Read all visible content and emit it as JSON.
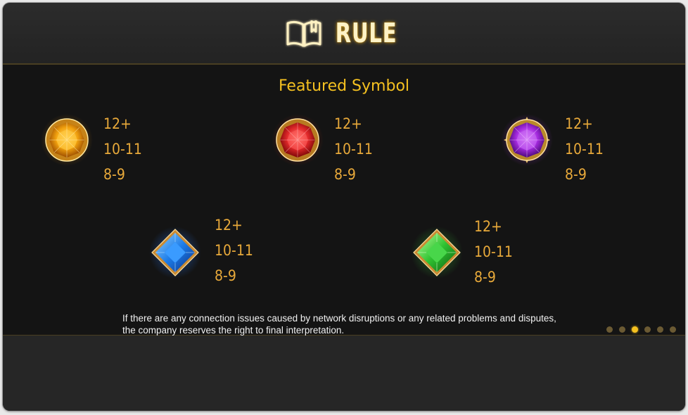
{
  "header": {
    "title": "RULE",
    "icon": "book-icon"
  },
  "main": {
    "section_title": "Featured Symbol",
    "symbols": [
      {
        "name": "orange-gem",
        "color": "#f2a20f",
        "pays": [
          "12+",
          "10-11",
          "8-9"
        ]
      },
      {
        "name": "red-gem",
        "color": "#e0282a",
        "pays": [
          "12+",
          "10-11",
          "8-9"
        ]
      },
      {
        "name": "purple-gem",
        "color": "#a62be0",
        "pays": [
          "12+",
          "10-11",
          "8-9"
        ]
      },
      {
        "name": "blue-gem",
        "color": "#1d7ce8",
        "pays": [
          "12+",
          "10-11",
          "8-9"
        ]
      },
      {
        "name": "green-gem",
        "color": "#2fc231",
        "pays": [
          "12+",
          "10-11",
          "8-9"
        ]
      }
    ],
    "notice_line1": "If there are any connection issues caused by network disruptions or any related problems and disputes,",
    "notice_line2": "the company reserves the right to final interpretation."
  },
  "pagination": {
    "total": 6,
    "current": 3
  }
}
